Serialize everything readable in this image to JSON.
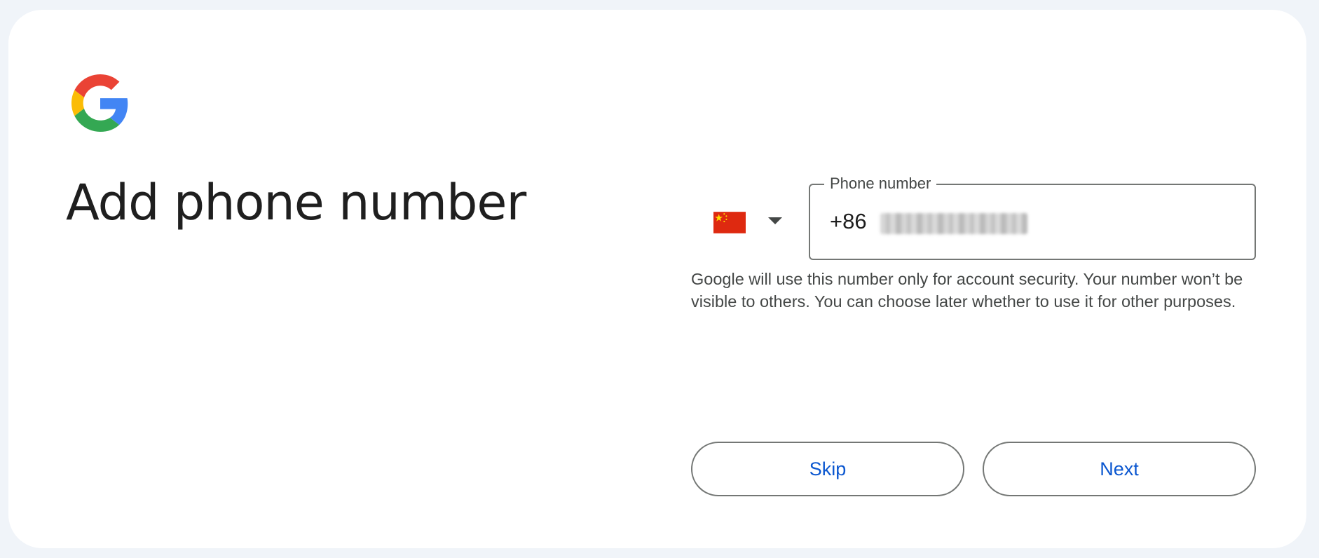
{
  "page": {
    "title": "Add phone number"
  },
  "brand": {
    "logo_icon": "google-g-icon",
    "colors": {
      "blue": "#4285F4",
      "red": "#EA4335",
      "yellow": "#FBBC05",
      "green": "#34A853",
      "link": "#0b57d0"
    }
  },
  "country_selector": {
    "flag_icon": "china-flag-icon",
    "dropdown_icon": "caret-down-icon"
  },
  "phone": {
    "label": "Phone number",
    "country_code": "+86"
  },
  "helper": {
    "text": "Google will use this number only for account security. Your number won’t be visible to others. You can choose later whether to use it for other purposes."
  },
  "actions": {
    "skip_label": "Skip",
    "next_label": "Next"
  }
}
